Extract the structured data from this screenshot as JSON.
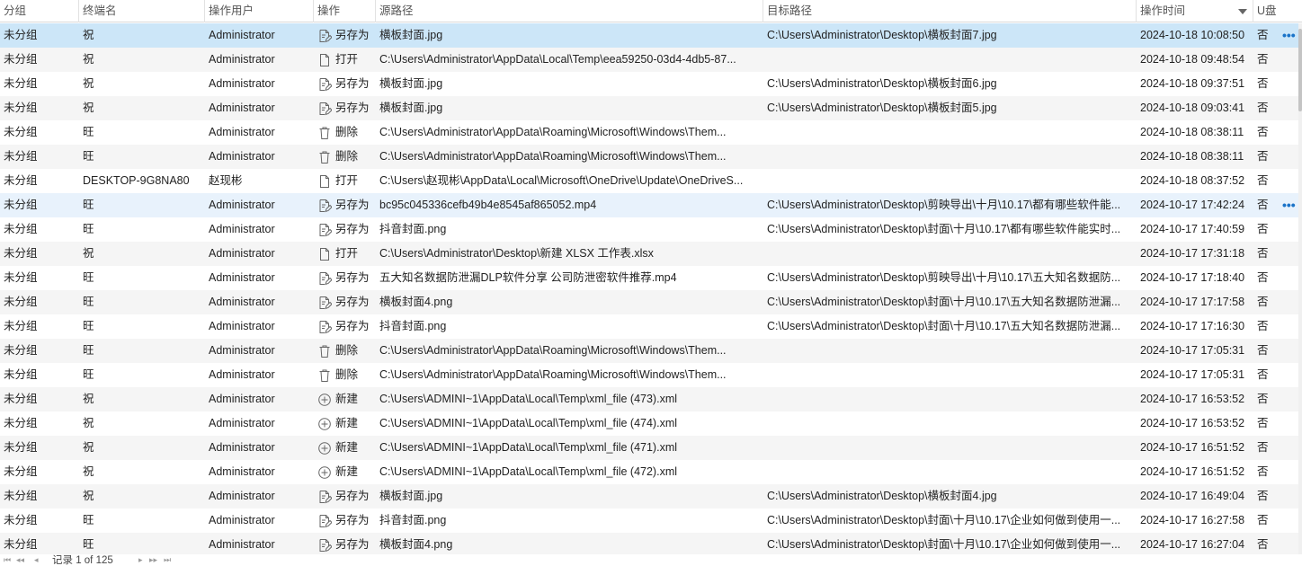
{
  "columns": {
    "group": "分组",
    "terminal": "终端名",
    "user": "操作用户",
    "op": "操作",
    "src": "源路径",
    "dst": "目标路径",
    "time": "操作时间",
    "usb": "U盘"
  },
  "ops": {
    "saveas": "另存为",
    "open": "打开",
    "delete": "删除",
    "create": "新建"
  },
  "rows": [
    {
      "group": "未分组",
      "terminal": "祝",
      "user": "Administrator",
      "op": "另存为",
      "src": "横板封面.jpg",
      "dst": "C:\\Users\\Administrator\\Desktop\\横板封面7.jpg",
      "time": "2024-10-18 10:08:50",
      "usb": "否",
      "more": "•••"
    },
    {
      "group": "未分组",
      "terminal": "祝",
      "user": "Administrator",
      "op": "打开",
      "src": "C:\\Users\\Administrator\\AppData\\Local\\Temp\\eea59250-03d4-4db5-87...",
      "dst": "",
      "time": "2024-10-18 09:48:54",
      "usb": "否",
      "more": ""
    },
    {
      "group": "未分组",
      "terminal": "祝",
      "user": "Administrator",
      "op": "另存为",
      "src": "横板封面.jpg",
      "dst": "C:\\Users\\Administrator\\Desktop\\横板封面6.jpg",
      "time": "2024-10-18 09:37:51",
      "usb": "否",
      "more": ""
    },
    {
      "group": "未分组",
      "terminal": "祝",
      "user": "Administrator",
      "op": "另存为",
      "src": "横板封面.jpg",
      "dst": "C:\\Users\\Administrator\\Desktop\\横板封面5.jpg",
      "time": "2024-10-18 09:03:41",
      "usb": "否",
      "more": ""
    },
    {
      "group": "未分组",
      "terminal": "旺",
      "user": "Administrator",
      "op": "删除",
      "src": "C:\\Users\\Administrator\\AppData\\Roaming\\Microsoft\\Windows\\Them...",
      "dst": "",
      "time": "2024-10-18 08:38:11",
      "usb": "否",
      "more": ""
    },
    {
      "group": "未分组",
      "terminal": "旺",
      "user": "Administrator",
      "op": "删除",
      "src": "C:\\Users\\Administrator\\AppData\\Roaming\\Microsoft\\Windows\\Them...",
      "dst": "",
      "time": "2024-10-18 08:38:11",
      "usb": "否",
      "more": ""
    },
    {
      "group": "未分组",
      "terminal": "DESKTOP-9G8NA80",
      "user": "赵现彬",
      "op": "打开",
      "src": "C:\\Users\\赵现彬\\AppData\\Local\\Microsoft\\OneDrive\\Update\\OneDriveS...",
      "dst": "",
      "time": "2024-10-18 08:37:52",
      "usb": "否",
      "more": ""
    },
    {
      "group": "未分组",
      "terminal": "旺",
      "user": "Administrator",
      "op": "另存为",
      "src": "bc95c045336cefb49b4e8545af865052.mp4",
      "dst": "C:\\Users\\Administrator\\Desktop\\剪映导出\\十月\\10.17\\都有哪些软件能...",
      "time": "2024-10-17 17:42:24",
      "usb": "否",
      "more": "•••"
    },
    {
      "group": "未分组",
      "terminal": "旺",
      "user": "Administrator",
      "op": "另存为",
      "src": "抖音封面.png",
      "dst": "C:\\Users\\Administrator\\Desktop\\封面\\十月\\10.17\\都有哪些软件能实时...",
      "time": "2024-10-17 17:40:59",
      "usb": "否",
      "more": ""
    },
    {
      "group": "未分组",
      "terminal": "祝",
      "user": "Administrator",
      "op": "打开",
      "src": "C:\\Users\\Administrator\\Desktop\\新建 XLSX 工作表.xlsx",
      "dst": "",
      "time": "2024-10-17 17:31:18",
      "usb": "否",
      "more": ""
    },
    {
      "group": "未分组",
      "terminal": "旺",
      "user": "Administrator",
      "op": "另存为",
      "src": "五大知名数据防泄漏DLP软件分享 公司防泄密软件推荐.mp4",
      "dst": "C:\\Users\\Administrator\\Desktop\\剪映导出\\十月\\10.17\\五大知名数据防...",
      "time": "2024-10-17 17:18:40",
      "usb": "否",
      "more": ""
    },
    {
      "group": "未分组",
      "terminal": "旺",
      "user": "Administrator",
      "op": "另存为",
      "src": "横板封面4.png",
      "dst": "C:\\Users\\Administrator\\Desktop\\封面\\十月\\10.17\\五大知名数据防泄漏...",
      "time": "2024-10-17 17:17:58",
      "usb": "否",
      "more": ""
    },
    {
      "group": "未分组",
      "terminal": "旺",
      "user": "Administrator",
      "op": "另存为",
      "src": "抖音封面.png",
      "dst": "C:\\Users\\Administrator\\Desktop\\封面\\十月\\10.17\\五大知名数据防泄漏...",
      "time": "2024-10-17 17:16:30",
      "usb": "否",
      "more": ""
    },
    {
      "group": "未分组",
      "terminal": "旺",
      "user": "Administrator",
      "op": "删除",
      "src": "C:\\Users\\Administrator\\AppData\\Roaming\\Microsoft\\Windows\\Them...",
      "dst": "",
      "time": "2024-10-17 17:05:31",
      "usb": "否",
      "more": ""
    },
    {
      "group": "未分组",
      "terminal": "旺",
      "user": "Administrator",
      "op": "删除",
      "src": "C:\\Users\\Administrator\\AppData\\Roaming\\Microsoft\\Windows\\Them...",
      "dst": "",
      "time": "2024-10-17 17:05:31",
      "usb": "否",
      "more": ""
    },
    {
      "group": "未分组",
      "terminal": "祝",
      "user": "Administrator",
      "op": "新建",
      "src": "C:\\Users\\ADMINI~1\\AppData\\Local\\Temp\\xml_file (473).xml",
      "dst": "",
      "time": "2024-10-17 16:53:52",
      "usb": "否",
      "more": ""
    },
    {
      "group": "未分组",
      "terminal": "祝",
      "user": "Administrator",
      "op": "新建",
      "src": "C:\\Users\\ADMINI~1\\AppData\\Local\\Temp\\xml_file (474).xml",
      "dst": "",
      "time": "2024-10-17 16:53:52",
      "usb": "否",
      "more": ""
    },
    {
      "group": "未分组",
      "terminal": "祝",
      "user": "Administrator",
      "op": "新建",
      "src": "C:\\Users\\ADMINI~1\\AppData\\Local\\Temp\\xml_file (471).xml",
      "dst": "",
      "time": "2024-10-17 16:51:52",
      "usb": "否",
      "more": ""
    },
    {
      "group": "未分组",
      "terminal": "祝",
      "user": "Administrator",
      "op": "新建",
      "src": "C:\\Users\\ADMINI~1\\AppData\\Local\\Temp\\xml_file (472).xml",
      "dst": "",
      "time": "2024-10-17 16:51:52",
      "usb": "否",
      "more": ""
    },
    {
      "group": "未分组",
      "terminal": "祝",
      "user": "Administrator",
      "op": "另存为",
      "src": "横板封面.jpg",
      "dst": "C:\\Users\\Administrator\\Desktop\\横板封面4.jpg",
      "time": "2024-10-17 16:49:04",
      "usb": "否",
      "more": ""
    },
    {
      "group": "未分组",
      "terminal": "旺",
      "user": "Administrator",
      "op": "另存为",
      "src": "抖音封面.png",
      "dst": "C:\\Users\\Administrator\\Desktop\\封面\\十月\\10.17\\企业如何做到使用一...",
      "time": "2024-10-17 16:27:58",
      "usb": "否",
      "more": ""
    },
    {
      "group": "未分组",
      "terminal": "旺",
      "user": "Administrator",
      "op": "另存为",
      "src": "横板封面4.png",
      "dst": "C:\\Users\\Administrator\\Desktop\\封面\\十月\\10.17\\企业如何做到使用一...",
      "time": "2024-10-17 16:27:04",
      "usb": "否",
      "more": ""
    }
  ],
  "row_states": {
    "selected": 0,
    "highlighted": 7
  },
  "icons": {
    "saveas": "save-as-icon",
    "open": "file-open-icon",
    "delete": "trash-icon",
    "create": "plus-circle-icon",
    "sort": "sort-desc-icon",
    "more": "more-dots-icon"
  },
  "colors": {
    "selected_row": "#cce6f8",
    "highlight_row": "#e8f2fc",
    "alt_row": "#f5f5f5",
    "link_blue": "#1a73c8"
  },
  "pager": {
    "record_text": "记录 1 of 125",
    "first": "⏮",
    "prev_page": "◂◂",
    "prev": "◂",
    "next": "▸",
    "next_page": "▸▸",
    "last": "⏭"
  }
}
